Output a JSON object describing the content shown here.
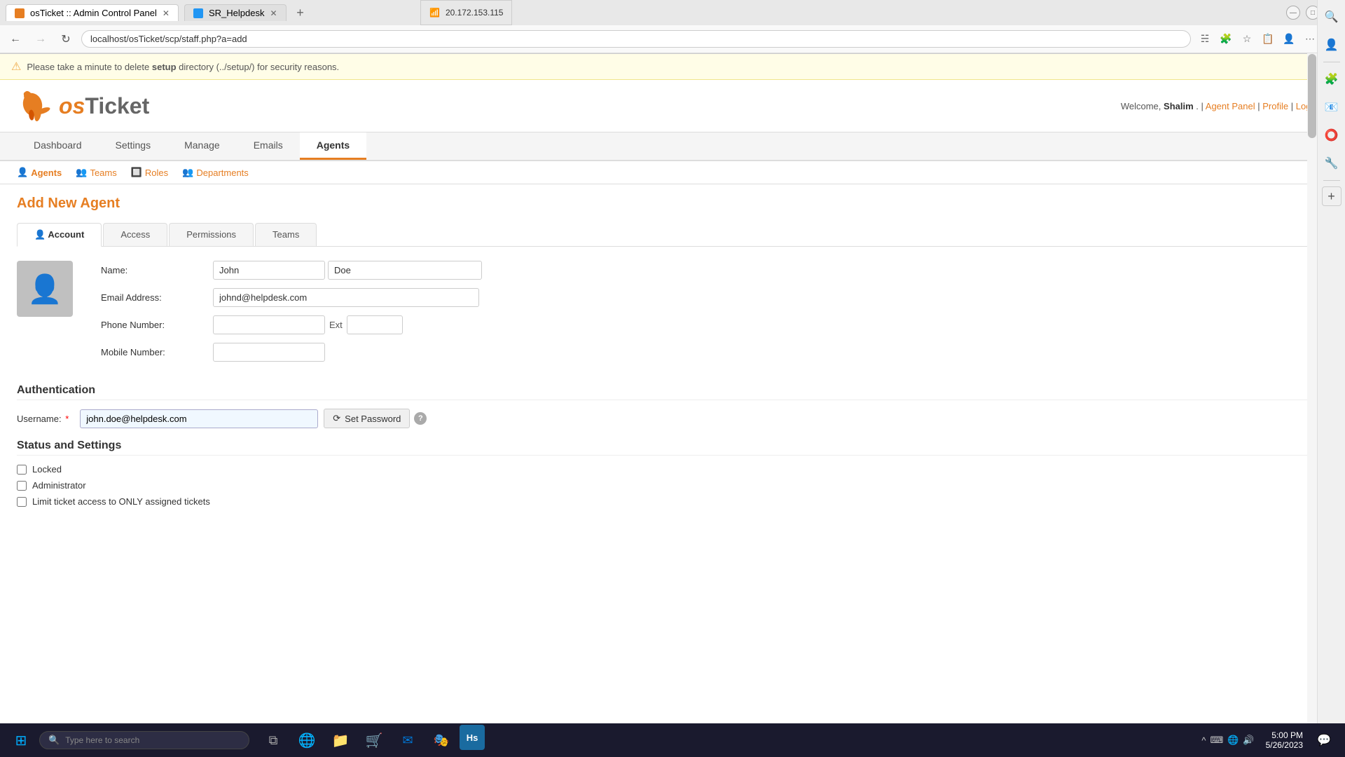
{
  "browser": {
    "tabs": [
      {
        "id": "tab1",
        "label": "osTicket :: Admin Control Panel",
        "active": true,
        "favicon_color": "#e67e22"
      },
      {
        "id": "tab2",
        "label": "SR_Helpdesk",
        "active": false,
        "favicon_color": "#2196f3"
      }
    ],
    "url": "localhost/osTicket/scp/staff.php?a=add",
    "ip_display": "20.172.153.115",
    "win_buttons": {
      "minimize": "—",
      "maximize": "□",
      "close": "✕"
    }
  },
  "security_warning": "Please take a minute to delete setup directory (../setup/) for security reasons.",
  "header": {
    "welcome_text": "Welcome,",
    "username": "Shalim",
    "links": [
      "Agent Panel",
      "Profile",
      "Log Out"
    ]
  },
  "nav": {
    "items": [
      "Dashboard",
      "Settings",
      "Manage",
      "Emails",
      "Agents"
    ],
    "active": "Agents"
  },
  "subnav": {
    "items": [
      "Agents",
      "Teams",
      "Roles",
      "Departments"
    ],
    "active": "Agents"
  },
  "page": {
    "title": "Add New Agent",
    "tabs": [
      "Account",
      "Access",
      "Permissions",
      "Teams"
    ],
    "active_tab": "Account"
  },
  "form": {
    "name_label": "Name:",
    "first_name": "John",
    "last_name": "Doe",
    "email_label": "Email Address:",
    "email_value": "johnd@helpdesk.com",
    "phone_label": "Phone Number:",
    "phone_value": "",
    "ext_label": "Ext",
    "ext_value": "",
    "mobile_label": "Mobile Number:",
    "mobile_value": "",
    "authentication_heading": "Authentication",
    "username_label": "Username:",
    "username_required": "*",
    "username_value": "john.doe@helpdesk.com",
    "set_password_label": "Set Password",
    "status_heading": "Status and Settings",
    "checkboxes": [
      {
        "label": "Locked",
        "checked": false
      },
      {
        "label": "Administrator",
        "checked": false
      },
      {
        "label": "Limit ticket access to ONLY assigned tickets",
        "checked": false
      }
    ]
  },
  "taskbar": {
    "search_placeholder": "Type here to search",
    "time": "5:00 PM",
    "date": "5/26/2023",
    "apps": [
      "⊞",
      "🔍",
      "📋",
      "🌐",
      "📁",
      "🛒",
      "✉",
      "🎭",
      "Hs"
    ]
  },
  "sidebar": {
    "icons": [
      "🔍",
      "👤",
      "🧩",
      "📧",
      "⭕",
      "🔧"
    ]
  }
}
